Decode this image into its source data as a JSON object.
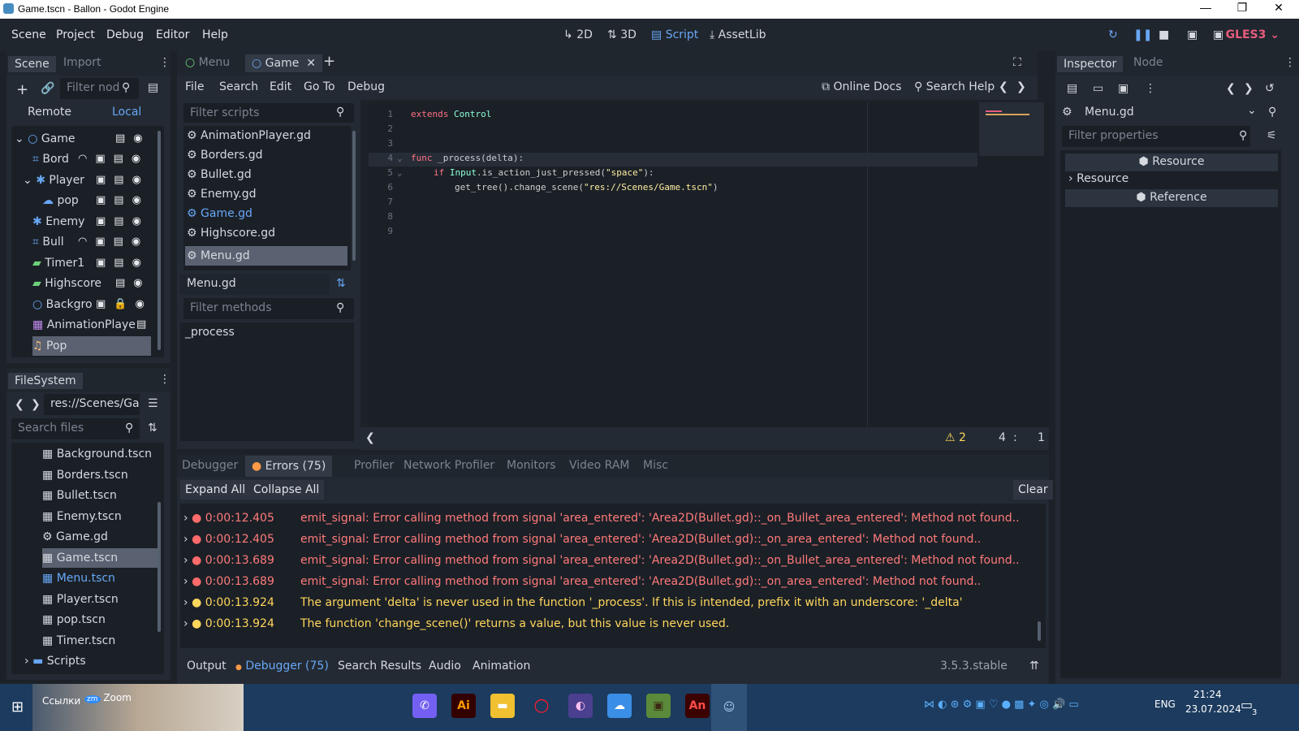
{
  "window": {
    "title": "Game.tscn - Ballon - Godot Engine",
    "minimize": "—",
    "maximize": "❐",
    "close": "✕"
  },
  "menu": [
    "Scene",
    "Project",
    "Debug",
    "Editor",
    "Help"
  ],
  "modes": {
    "m2d": "2D",
    "m3d": "3D",
    "script": "Script",
    "assetlib": "AssetLib"
  },
  "renderer": "GLES3",
  "scene_dock": {
    "tabs": [
      "Scene",
      "Import"
    ],
    "filter_placeholder": "Filter nod",
    "remote": "Remote",
    "local": "Local",
    "nodes": [
      "Game",
      "Bord",
      "Player",
      "pop",
      "Enemy",
      "Bull",
      "Timer1",
      "Highscore",
      "Backgro",
      "AnimationPlaye",
      "Pop"
    ]
  },
  "filesystem": {
    "title": "FileSystem",
    "path": "res://Scenes/Ga",
    "search_placeholder": "Search files",
    "files": [
      "Background.tscn",
      "Borders.tscn",
      "Bullet.tscn",
      "Enemy.tscn",
      "Game.gd",
      "Game.tscn",
      "Menu.tscn",
      "Player.tscn",
      "pop.tscn",
      "Timer.tscn",
      "Scripts"
    ]
  },
  "editor_tabs": [
    "Menu",
    "Game"
  ],
  "script_menu": [
    "File",
    "Search",
    "Edit",
    "Go To",
    "Debug"
  ],
  "online_docs": "Online Docs",
  "search_help": "Search Help",
  "scripts": {
    "filter_placeholder": "Filter scripts",
    "list": [
      "AnimationPlayer.gd",
      "Borders.gd",
      "Bullet.gd",
      "Enemy.gd",
      "Game.gd",
      "Highscore.gd",
      "Menu.gd"
    ],
    "current": "Menu.gd",
    "methods_placeholder": "Filter methods",
    "methods": [
      "_process"
    ]
  },
  "code": {
    "lines": [
      "1",
      "2",
      "3",
      "4",
      "5",
      "6",
      "7",
      "8",
      "9"
    ],
    "l1_kw": "extends",
    "l1_cls": "Control",
    "l4_kw": "func",
    "l4_rest": " _process(delta):",
    "l5_kw": "if",
    "l5_cls": "Input",
    "l5_rest": ".is_action_just_pressed(",
    "l5_str": "\"space\"",
    "l5_end": "):",
    "l6_rest": "get_tree().change_scene(",
    "l6_str": "\"res://Scenes/Game.tscn\"",
    "l6_end": ")"
  },
  "status": {
    "warnings": "2",
    "line": "4",
    "sep": ":",
    "col": "1"
  },
  "inspector": {
    "tabs": [
      "Inspector",
      "Node"
    ],
    "object": "Menu.gd",
    "filter_placeholder": "Filter properties",
    "section": "Resource",
    "sub": "Resource",
    "section2": "Reference"
  },
  "bottom_tabs": [
    "Debugger",
    "Errors (75)",
    "Profiler",
    "Network Profiler",
    "Monitors",
    "Video RAM",
    "Misc"
  ],
  "bottom_buttons": {
    "expand": "Expand All",
    "collapse": "Collapse All",
    "clear": "Clear"
  },
  "errors": [
    {
      "time": "0:00:12.405",
      "msg": "emit_signal: Error calling method from signal 'area_entered': 'Area2D(Bullet.gd)::_on_Bullet_area_entered': Method not found..",
      "type": "error"
    },
    {
      "time": "0:00:12.405",
      "msg": "emit_signal: Error calling method from signal 'area_entered': 'Area2D(Bullet.gd)::_on_area_entered': Method not found..",
      "type": "error"
    },
    {
      "time": "0:00:13.689",
      "msg": "emit_signal: Error calling method from signal 'area_entered': 'Area2D(Bullet.gd)::_on_Bullet_area_entered': Method not found..",
      "type": "error"
    },
    {
      "time": "0:00:13.689",
      "msg": "emit_signal: Error calling method from signal 'area_entered': 'Area2D(Bullet.gd)::_on_area_entered': Method not found..",
      "type": "error"
    },
    {
      "time": "0:00:13.924",
      "msg": "The argument 'delta' is never used in the function '_process'. If this is intended, prefix it with an underscore: '_delta'",
      "type": "warning"
    },
    {
      "time": "0:00:13.924",
      "msg": "The function 'change_scene()' returns a value, but this value is never used.",
      "type": "warning"
    }
  ],
  "bottom_bar": [
    "Output",
    "Debugger (75)",
    "Search Results",
    "Audio",
    "Animation"
  ],
  "version": "3.5.3.stable",
  "taskbar": {
    "links": "Ссылки",
    "zoom": "Zoom",
    "lang": "ENG",
    "time": "21:24",
    "date": "23.07.2024",
    "notif": "3"
  },
  "colors": {
    "accent": "#68a7f5",
    "error": "#ff7a7a",
    "warning": "#ffd65c"
  }
}
